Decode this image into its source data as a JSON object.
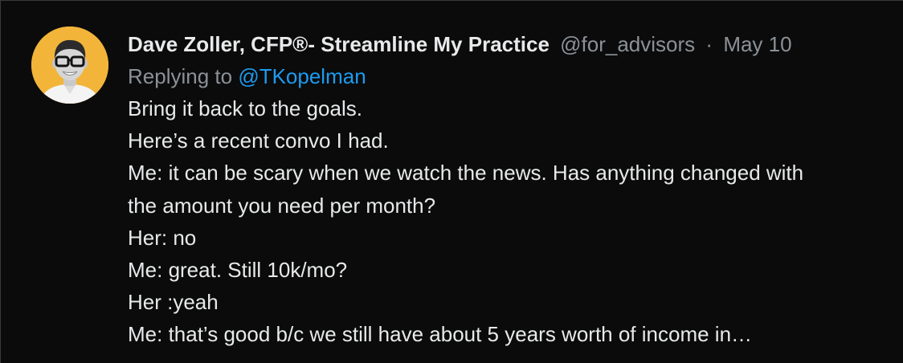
{
  "tweet": {
    "author": {
      "display_name": "Dave Zoller, CFP®- Streamline My Practice",
      "handle": "@for_advisors",
      "separator": "·",
      "date": "May 10"
    },
    "replying_to": {
      "prefix": "Replying to",
      "mention": "@TKopelman"
    },
    "body_lines": [
      "Bring it back to the goals.",
      "Here’s a recent convo I had.",
      "Me: it can be scary when we watch the news. Has anything changed with",
      "the amount you need per month?",
      "Her: no",
      "Me: great. Still 10k/mo?",
      "Her :yeah",
      "Me: that’s good b/c we still have about 5 years worth of income in…"
    ]
  },
  "colors": {
    "background": "#0b0b0b",
    "text_primary": "#e7e9ea",
    "text_secondary": "#8b9197",
    "link": "#1d9bf0",
    "avatar_bg": "#f2b53a"
  }
}
